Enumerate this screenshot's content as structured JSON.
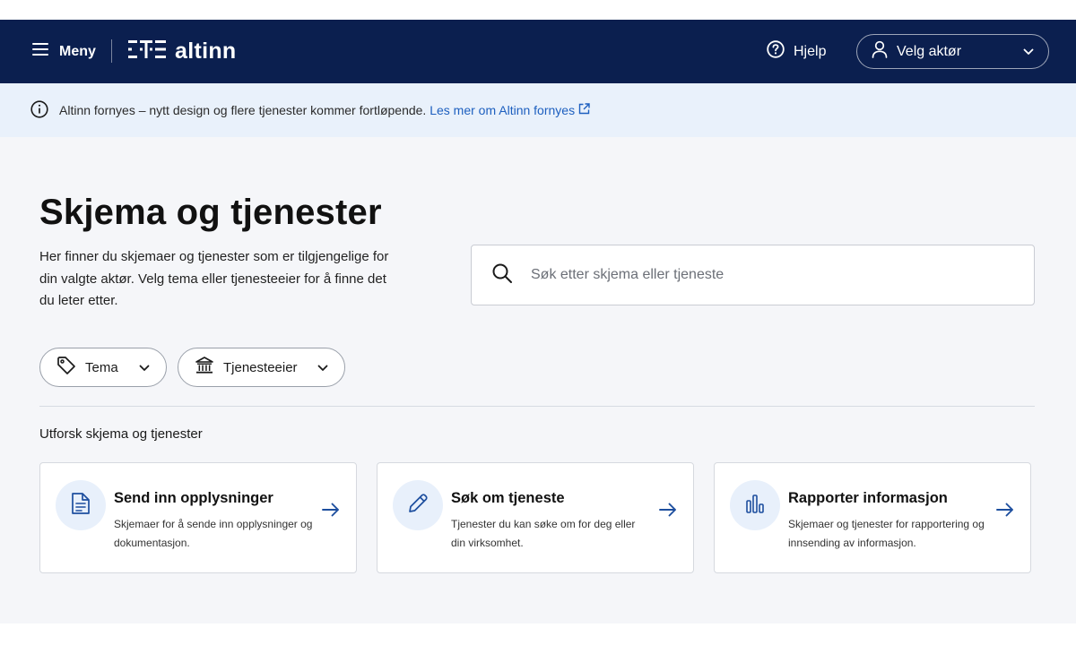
{
  "header": {
    "menu_label": "Meny",
    "logo_text": "altinn",
    "help_label": "Hjelp",
    "actor_label": "Velg aktør"
  },
  "banner": {
    "text": "Altinn fornyes – nytt design og flere tjenester kommer fortløpende.",
    "link_text": "Les mer om Altinn fornyes"
  },
  "main": {
    "title": "Skjema og tjenester",
    "intro": "Her finner du skjemaer og tjenester som er tilgjengelige for din valgte aktør. Velg tema eller tjenesteeier for å finne det du leter etter.",
    "search_placeholder": "Søk etter skjema eller tjeneste",
    "filters": [
      {
        "label": "Tema",
        "icon": "tag-icon"
      },
      {
        "label": "Tjenesteeier",
        "icon": "institution-icon"
      }
    ],
    "section_title": "Utforsk skjema og tjenester",
    "cards": [
      {
        "title": "Send inn opplysninger",
        "desc": "Skjemaer for å sende inn opplysninger og dokumentasjon.",
        "icon": "document-icon"
      },
      {
        "title": "Søk om tjeneste",
        "desc": "Tjenester du kan søke om for deg eller din virksomhet.",
        "icon": "pencil-icon"
      },
      {
        "title": "Rapporter informasjon",
        "desc": "Skjemaer og tjenester for rapportering og innsending av informasjon.",
        "icon": "bar-chart-icon"
      }
    ]
  },
  "colors": {
    "header_bg": "#0b1f4f",
    "banner_bg": "#e9f1fb",
    "link": "#1d5fbf",
    "icon_accent": "#1d4e9e",
    "card_icon_bg": "#e8f0fb"
  }
}
